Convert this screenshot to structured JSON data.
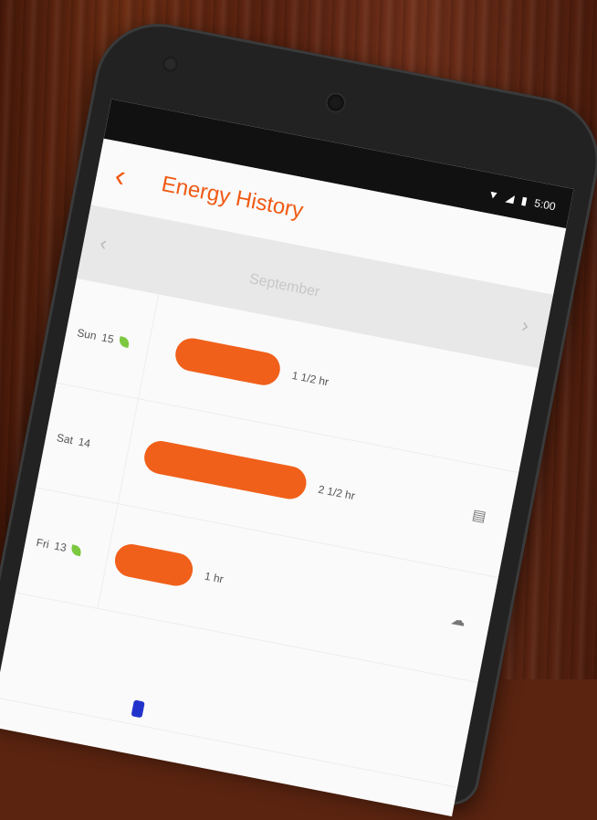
{
  "app": {
    "title": "Energy History",
    "back_icon": "chevron-left-icon"
  },
  "status_bar": {
    "time": "5:00",
    "icons": [
      "wifi-icon",
      "signal-icon",
      "battery-icon"
    ]
  },
  "month_nav": {
    "label": "September",
    "prev_icon": "chevron-left-icon",
    "next_icon": "chevron-right-icon"
  },
  "rows": [
    {
      "day": "Sun",
      "date": "15",
      "eco": true,
      "duration": "1 1/2 hr",
      "side_icon": ""
    },
    {
      "day": "Sat",
      "date": "14",
      "eco": false,
      "duration": "2 1/2 hr",
      "side_icon": "thermostat-icon"
    },
    {
      "day": "Fri",
      "date": "13",
      "eco": true,
      "duration": "1 hr",
      "side_icon": "weather-icon"
    }
  ],
  "colors": {
    "accent": "#f05a14",
    "bar": "#f0601a",
    "eco_leaf": "#7cc940"
  }
}
